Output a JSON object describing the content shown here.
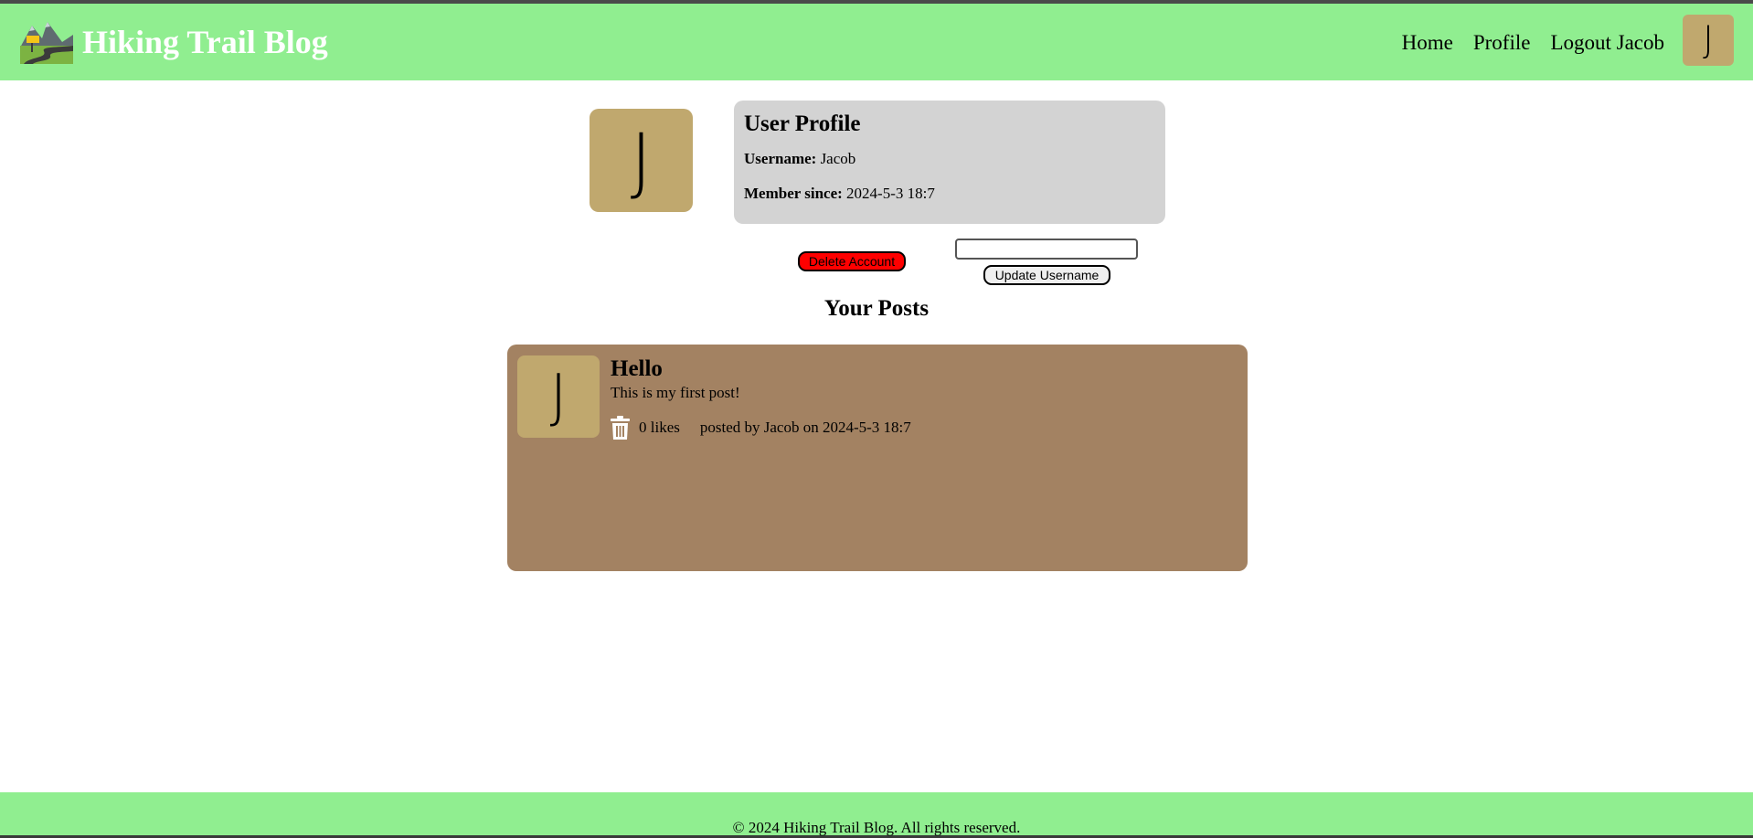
{
  "header": {
    "site_title": "Hiking Trail Blog",
    "logo_icon": "mountain-trail-logo",
    "nav": {
      "home": "Home",
      "profile": "Profile",
      "logout": "Logout Jacob"
    },
    "avatar_letter": "J"
  },
  "profile": {
    "avatar_letter": "J",
    "title": "User Profile",
    "username_label": "Username:",
    "username_value": "Jacob",
    "member_since_label": "Member since:",
    "member_since_value": "2024-5-3 18:7"
  },
  "actions": {
    "delete_label": "Delete Account",
    "username_input_value": "",
    "update_label": "Update Username"
  },
  "posts_section": {
    "title": "Your Posts",
    "posts": [
      {
        "avatar_letter": "J",
        "title": "Hello",
        "body": "This is my first post!",
        "delete_icon": "trash-icon",
        "likes": "0 likes",
        "byline": "posted by Jacob on 2024-5-3 18:7"
      }
    ]
  },
  "footer": {
    "text": "© 2024 Hiking Trail Blog. All rights reserved."
  },
  "colors": {
    "header_bg": "#90ee90",
    "avatar_bg": "#c0a86e",
    "profile_card_bg": "#d3d3d3",
    "post_card_bg": "#a38262",
    "delete_button": "#ff0000"
  }
}
